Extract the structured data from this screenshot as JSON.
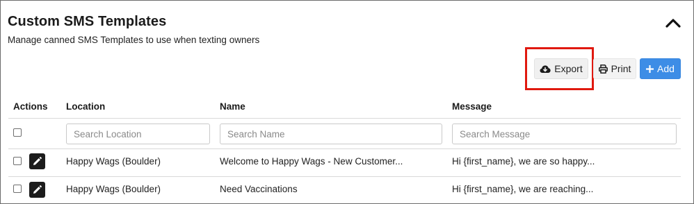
{
  "header": {
    "title": "Custom SMS Templates",
    "subtitle": "Manage canned SMS Templates to use when texting owners"
  },
  "toolbar": {
    "export_label": "Export",
    "export_icon": "cloud-download-icon",
    "print_label": "Print",
    "print_icon": "printer-icon",
    "add_label": "Add",
    "add_icon": "plus-icon",
    "add_color": "#3d8de6",
    "highlight_color": "#e0190f"
  },
  "table": {
    "columns": [
      "Actions",
      "Location",
      "Name",
      "Message"
    ],
    "search": {
      "location_placeholder": "Search Location",
      "name_placeholder": "Search Name",
      "message_placeholder": "Search Message"
    },
    "rows": [
      {
        "location": "Happy Wags (Boulder)",
        "name": "Welcome to Happy Wags - New Customer...",
        "message": "Hi {first_name}, we are so happy..."
      },
      {
        "location": "Happy Wags (Boulder)",
        "name": "Need Vaccinations",
        "message": "Hi {first_name}, we are reaching..."
      }
    ]
  }
}
